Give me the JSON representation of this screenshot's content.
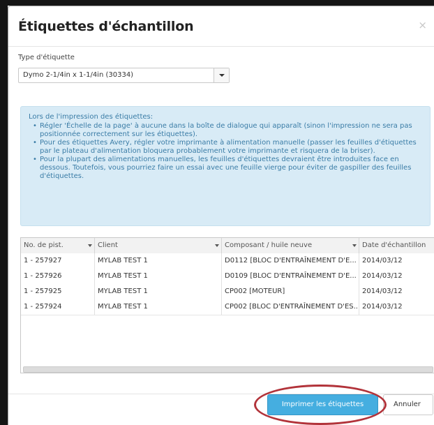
{
  "dialog": {
    "title": "Étiquettes d'échantillon",
    "close_label": "×"
  },
  "label_type": {
    "label": "Type d'étiquette",
    "selected": "Dymo 2-1/4in x 1-1/4in (30334)"
  },
  "info": {
    "intro": "Lors de l'impression des étiquettes:",
    "items": [
      "Régler 'Échelle de la page' à aucune dans la boîte de dialogue qui apparaît (sinon l'impression ne sera pas positionnée correctement sur les étiquettes).",
      "Pour des étiquettes Avery, régler votre imprimante à alimentation manuelle (passer les feuilles d'étiquettes par le plateau d'alimentation bloquera probablement votre imprimante et risquera de la briser).",
      "Pour la plupart des alimentations manuelles, les feuilles d'étiquettes devraient être introduites face en dessous. Toutefois, vous pourriez faire un essai avec une feuille vierge pour éviter de gaspiller des feuilles d'étiquettes."
    ]
  },
  "table": {
    "columns": [
      "No. de pist.",
      "Client",
      "Composant / huile neuve",
      "Date d'échantillon"
    ],
    "rows": [
      [
        "1 - 257927",
        "MYLAB TEST 1",
        "D0112 [BLOC D'ENTRAÎNEMENT D'E...",
        "2014/03/12"
      ],
      [
        "1 - 257926",
        "MYLAB TEST 1",
        "D0109 [BLOC D'ENTRAÎNEMENT D'E...",
        "2014/03/12"
      ],
      [
        "1 - 257925",
        "MYLAB TEST 1",
        "CP002 [MOTEUR]",
        "2014/03/12"
      ],
      [
        "1 - 257924",
        "MYLAB TEST 1",
        "CP002 [BLOC D'ENTRAÎNEMENT D'ES...",
        "2014/03/12"
      ]
    ]
  },
  "footer": {
    "print_label": "Imprimer les étiquettes",
    "cancel_label": "Annuler"
  },
  "colors": {
    "primary_button": "#45aee0",
    "info_background": "#d8ebf6",
    "info_text": "#3a7ca6",
    "highlight_oval": "#b2333a"
  }
}
